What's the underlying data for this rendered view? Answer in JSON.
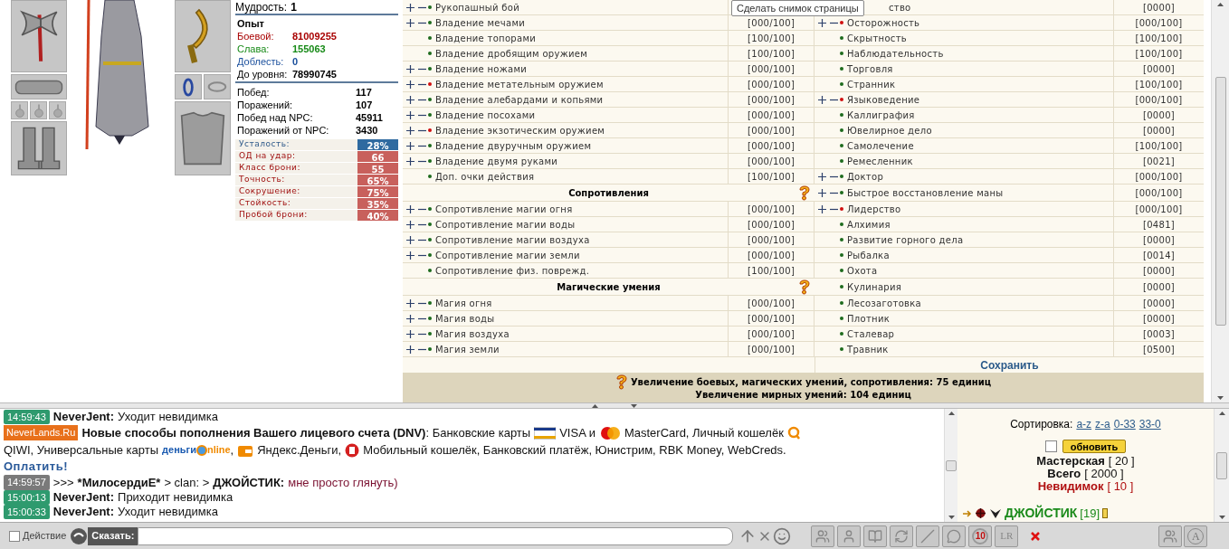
{
  "stats": {
    "wisdom": {
      "label": "Мудрость:",
      "value": "1"
    },
    "experience": {
      "title": "Опыт",
      "rows": [
        {
          "label": "Боевой:",
          "value": "81009255",
          "color": "#a80000"
        },
        {
          "label": "Слава:",
          "value": "155063",
          "color": "#178a17"
        },
        {
          "label": "Доблесть:",
          "value": "0",
          "color": "#1a4f9c"
        },
        {
          "label": "До уровня:",
          "value": "78990745",
          "color": "#000000"
        }
      ]
    },
    "record": [
      {
        "label": "Побед:",
        "value": "117"
      },
      {
        "label": "Поражений:",
        "value": "107"
      },
      {
        "label": "Побед над NPC:",
        "value": "45911"
      },
      {
        "label": "Поражений от NPC:",
        "value": "3430"
      }
    ],
    "combat": [
      {
        "label": "Усталость:",
        "value": "28%",
        "color": "#2f6aa0"
      },
      {
        "label": "ОД на удар:",
        "value": "66",
        "color": "#c8605c"
      },
      {
        "label": "Класс брони:",
        "value": "55",
        "color": "#c8605c"
      },
      {
        "label": "Точность:",
        "value": "65%",
        "color": "#c8605c"
      },
      {
        "label": "Сокрушение:",
        "value": "75%",
        "color": "#c8605c"
      },
      {
        "label": "Стойкость:",
        "value": "35%",
        "color": "#c8605c"
      },
      {
        "label": "Пробой брони:",
        "value": "40%",
        "color": "#c8605c"
      }
    ]
  },
  "tooltip": "Сделать снимок страницы",
  "skills": {
    "rows": [
      {
        "left": {
          "kind": "skill",
          "name": "Рукопашный бой",
          "controls": true,
          "color": "#1d6b1d"
        },
        "right": {
          "kind": "partial",
          "name": "ство",
          "value": "[0000]"
        }
      },
      {
        "left": {
          "kind": "skill",
          "name": "Владение мечами",
          "value": "[000/100]",
          "controls": true,
          "color": "#1d6b1d"
        },
        "right": {
          "kind": "skill",
          "name": "Осторожность",
          "value": "[000/100]",
          "controls": true,
          "color": "#d01010"
        }
      },
      {
        "left": {
          "kind": "skill",
          "name": "Владение топорами",
          "value": "[100/100]",
          "controls": false,
          "color": "#1d6b1d"
        },
        "right": {
          "kind": "skill",
          "name": "Скрытность",
          "value": "[100/100]",
          "controls": false,
          "color": "#1d6b1d"
        }
      },
      {
        "left": {
          "kind": "skill",
          "name": "Владение дробящим оружием",
          "value": "[100/100]",
          "controls": false,
          "color": "#1d6b1d"
        },
        "right": {
          "kind": "skill",
          "name": "Наблюдательность",
          "value": "[100/100]",
          "controls": false,
          "color": "#1d6b1d"
        }
      },
      {
        "left": {
          "kind": "skill",
          "name": "Владение ножами",
          "value": "[000/100]",
          "controls": true,
          "color": "#1d6b1d"
        },
        "right": {
          "kind": "skill",
          "name": "Торговля",
          "value": "[0000]",
          "controls": false,
          "color": "#1d6b1d"
        }
      },
      {
        "left": {
          "kind": "skill",
          "name": "Владение метательным оружием",
          "value": "[000/100]",
          "controls": true,
          "color": "#d01010"
        },
        "right": {
          "kind": "skill",
          "name": "Странник",
          "value": "[100/100]",
          "controls": false,
          "color": "#1d6b1d"
        }
      },
      {
        "left": {
          "kind": "skill",
          "name": "Владение алебардами и копьями",
          "value": "[000/100]",
          "controls": true,
          "color": "#1d6b1d"
        },
        "right": {
          "kind": "skill",
          "name": "Языковедение",
          "value": "[000/100]",
          "controls": true,
          "color": "#d01010"
        }
      },
      {
        "left": {
          "kind": "skill",
          "name": "Владение посохами",
          "value": "[000/100]",
          "controls": true,
          "color": "#1d6b1d"
        },
        "right": {
          "kind": "skill",
          "name": "Каллиграфия",
          "value": "[0000]",
          "controls": false,
          "color": "#1d6b1d"
        }
      },
      {
        "left": {
          "kind": "skill",
          "name": "Владение экзотическим оружием",
          "value": "[000/100]",
          "controls": true,
          "color": "#d01010"
        },
        "right": {
          "kind": "skill",
          "name": "Ювелирное дело",
          "value": "[0000]",
          "controls": false,
          "color": "#1d6b1d"
        }
      },
      {
        "left": {
          "kind": "skill",
          "name": "Владение двуручным оружием",
          "value": "[000/100]",
          "controls": true,
          "color": "#1d6b1d"
        },
        "right": {
          "kind": "skill",
          "name": "Самолечение",
          "value": "[100/100]",
          "controls": false,
          "color": "#1d6b1d"
        }
      },
      {
        "left": {
          "kind": "skill",
          "name": "Владение двумя руками",
          "value": "[000/100]",
          "controls": true,
          "color": "#1d6b1d"
        },
        "right": {
          "kind": "skill",
          "name": "Ремесленник",
          "value": "[0021]",
          "controls": false,
          "color": "#1d6b1d"
        }
      },
      {
        "left": {
          "kind": "skill",
          "name": "Доп. очки действия",
          "value": "[100/100]",
          "controls": false,
          "color": "#1d6b1d"
        },
        "right": {
          "kind": "skill",
          "name": "Доктор",
          "value": "[000/100]",
          "controls": true,
          "color": "#1d6b1d"
        }
      },
      {
        "left": {
          "kind": "header",
          "name": "Сопротивления"
        },
        "right": {
          "kind": "skill",
          "name": "Быстрое восстановление маны",
          "value": "[000/100]",
          "controls": true,
          "color": "#1d6b1d"
        }
      },
      {
        "left": {
          "kind": "skill",
          "name": "Сопротивление магии огня",
          "value": "[000/100]",
          "controls": true,
          "color": "#1d6b1d"
        },
        "right": {
          "kind": "skill",
          "name": "Лидерство",
          "value": "[000/100]",
          "controls": true,
          "color": "#d01010"
        }
      },
      {
        "left": {
          "kind": "skill",
          "name": "Сопротивление магии воды",
          "value": "[000/100]",
          "controls": true,
          "color": "#1d6b1d"
        },
        "right": {
          "kind": "skill",
          "name": "Алхимия",
          "value": "[0481]",
          "controls": false,
          "color": "#1d6b1d"
        }
      },
      {
        "left": {
          "kind": "skill",
          "name": "Сопротивление магии воздуха",
          "value": "[000/100]",
          "controls": true,
          "color": "#1d6b1d"
        },
        "right": {
          "kind": "skill",
          "name": "Развитие горного дела",
          "value": "[0000]",
          "controls": false,
          "color": "#1d6b1d"
        }
      },
      {
        "left": {
          "kind": "skill",
          "name": "Сопротивление магии земли",
          "value": "[000/100]",
          "controls": true,
          "color": "#1d6b1d"
        },
        "right": {
          "kind": "skill",
          "name": "Рыбалка",
          "value": "[0014]",
          "controls": false,
          "color": "#1d6b1d"
        }
      },
      {
        "left": {
          "kind": "skill",
          "name": "Сопротивление физ. поврежд.",
          "value": "[100/100]",
          "controls": false,
          "color": "#1d6b1d"
        },
        "right": {
          "kind": "skill",
          "name": "Охота",
          "value": "[0000]",
          "controls": false,
          "color": "#1d6b1d"
        }
      },
      {
        "left": {
          "kind": "header",
          "name": "Магические умения"
        },
        "right": {
          "kind": "skill",
          "name": "Кулинария",
          "value": "[0000]",
          "controls": false,
          "color": "#1d6b1d"
        }
      },
      {
        "left": {
          "kind": "skill",
          "name": "Магия огня",
          "value": "[000/100]",
          "controls": true,
          "color": "#1d6b1d"
        },
        "right": {
          "kind": "skill",
          "name": "Лесозаготовка",
          "value": "[0000]",
          "controls": false,
          "color": "#1d6b1d"
        }
      },
      {
        "left": {
          "kind": "skill",
          "name": "Магия воды",
          "value": "[000/100]",
          "controls": true,
          "color": "#1d6b1d"
        },
        "right": {
          "kind": "skill",
          "name": "Плотник",
          "value": "[0000]",
          "controls": false,
          "color": "#1d6b1d"
        }
      },
      {
        "left": {
          "kind": "skill",
          "name": "Магия воздуха",
          "value": "[000/100]",
          "controls": true,
          "color": "#1d6b1d"
        },
        "right": {
          "kind": "skill",
          "name": "Сталевар",
          "value": "[0003]",
          "controls": false,
          "color": "#1d6b1d"
        }
      },
      {
        "left": {
          "kind": "skill",
          "name": "Магия земли",
          "value": "[000/100]",
          "controls": true,
          "color": "#1d6b1d"
        },
        "right": {
          "kind": "skill",
          "name": "Травник",
          "value": "[0500]",
          "controls": false,
          "color": "#1d6b1d"
        }
      }
    ],
    "save": "Сохранить",
    "footer": [
      "Увеличение боевых, магических умений, сопротивления: 75 единиц",
      "Увеличение мирных умений: 104 единиц"
    ]
  },
  "chat": [
    {
      "kind": "system",
      "time": "14:59:43",
      "color": "#2e9a6e",
      "name": "NeverJent:",
      "text": "Уходит невидимка"
    },
    {
      "kind": "news",
      "badge": "NeverLands.Ru",
      "lines": [
        [
          {
            "kind": "bold",
            "text": "Новые способы пополнения Вашего лицевого счета (DNV)"
          },
          {
            "kind": "text",
            "text": ": Банковские карты"
          },
          {
            "kind": "icon"
          },
          {
            "kind": "text",
            "text": "VISA и"
          },
          {
            "kind": "icon"
          },
          {
            "kind": "text",
            "text": "MasterCard, Личный кошелёк"
          },
          {
            "kind": "icon"
          }
        ],
        [
          {
            "kind": "text",
            "text": "QIWI, Универсальные карты"
          },
          {
            "kind": "logo",
            "parts": [
              "деньги",
              "nline"
            ]
          },
          {
            "kind": "text",
            "text": ","
          },
          {
            "kind": "icon"
          },
          {
            "kind": "text",
            "text": "Яндекс.Деньги,"
          },
          {
            "kind": "icon"
          },
          {
            "kind": "text",
            "text": "Мобильный кошелёк, Банковский платёж, Юнистрим, RBK Money, WebCreds."
          }
        ]
      ]
    },
    {
      "kind": "link",
      "text": "Оплатить!"
    },
    {
      "kind": "private",
      "time": "14:59:57",
      "color": "#7a7a7a",
      "prefix": ">>>",
      "from": "*МилосердиЕ*",
      "channel": "> clan: >",
      "to": "ДЖОЙСТИК:",
      "text": "мне просто глянуть)"
    },
    {
      "kind": "system",
      "time": "15:00:13",
      "color": "#2e9a6e",
      "name": "NeverJent:",
      "text": "Приходит невидимка"
    },
    {
      "kind": "system",
      "time": "15:00:33",
      "color": "#2e9a6e",
      "name": "NeverJent:",
      "text": "Уходит невидимка"
    }
  ],
  "online": {
    "sort_label": "Сортировка:",
    "sort_links": [
      "a-z",
      "z-a",
      "0-33",
      "33-0"
    ],
    "refresh_checked": false,
    "refresh": "обновить",
    "counts": [
      {
        "label": "Мастерская",
        "value": "[ 20 ]",
        "color": "#111111"
      },
      {
        "label": "Всего",
        "value": "[ 2000 ]",
        "color": "#111111"
      },
      {
        "label": "Невидимок",
        "value": "[ 10 ]",
        "color": "#b01010"
      }
    ],
    "players": [
      {
        "name": "ДЖОЙСТИК",
        "level": "[19]"
      }
    ]
  },
  "toolbar": {
    "action_label": "Действие",
    "action_checked": false,
    "say_label": "Сказать:",
    "counter": "10",
    "lr": "LR",
    "font_button": "A"
  }
}
